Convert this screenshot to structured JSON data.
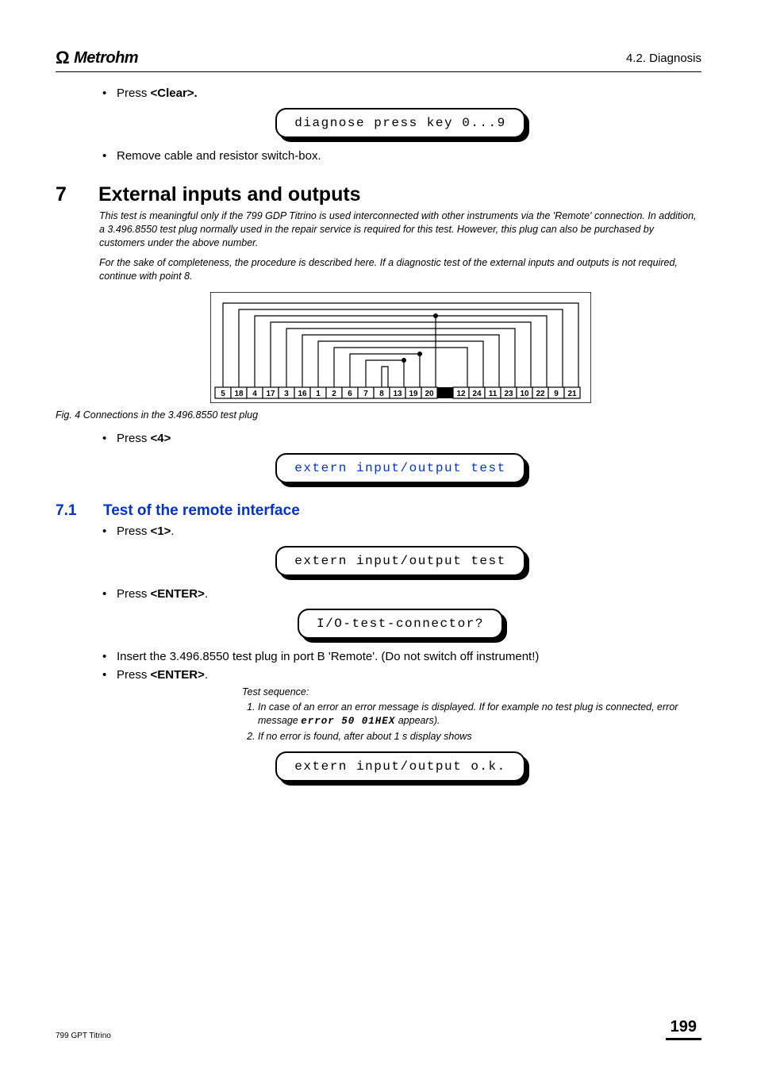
{
  "header": {
    "brand": "Metrohm",
    "section_label": "4.2. Diagnosis"
  },
  "intro_bullets": {
    "press_text": "Press ",
    "clear_key": "<Clear>.",
    "remove_text": "Remove cable and resistor switch-box."
  },
  "displays": {
    "diagnose": "diagnose press key 0...9",
    "extern_test_blue": "extern input/output test",
    "extern_test": "extern input/output test",
    "io_connector": "I/O-test-connector?",
    "extern_ok": "extern input/output o.k."
  },
  "section7": {
    "num": "7",
    "title": "External inputs and outputs",
    "note1": "This test is meaningful only if the 799 GDP Titrino is used interconnected with other instruments via the 'Remote' connection. In addition, a 3.496.8550 test plug normally used in the repair service is required for this test. However, this plug can also be purchased by customers under the above number.",
    "note2": "For the sake of completeness, the procedure is described here. If a diagnostic test of the external inputs and outputs is not required, continue with point 8.",
    "fig_caption": "Fig. 4      Connections in the 3.496.8550 test plug",
    "press4_text": "Press ",
    "press4_key": "<4>",
    "plug_pins": [
      "5",
      "18",
      "4",
      "17",
      "3",
      "16",
      "1",
      "2",
      "6",
      "7",
      "8",
      "13",
      "19",
      "20",
      "",
      "12",
      "24",
      "11",
      "23",
      "10",
      "22",
      "9",
      "21"
    ]
  },
  "section71": {
    "num": "7.1",
    "title": "Test of the remote interface",
    "press1_text": "Press ",
    "press1_key": "<1>",
    "press1_suffix": ".",
    "press_enter_text": "Press ",
    "enter_key": "<ENTER>",
    "enter_suffix": ".",
    "insert_text": "Insert the 3.496.8550 test plug in port B 'Remote'. (Do not switch off instrument!)",
    "press_enter2_text": "Press ",
    "test_seq_title": "Test sequence:",
    "seq1a": "In case of an error an error message is displayed. If for example no test plug is connected, error message  ",
    "seq1_code": "error 50    01HEX",
    "seq1b": " appears).",
    "seq2": "If no error is found, after about 1 s display shows"
  },
  "footer": {
    "left": "799 GPT Titrino",
    "page": "199"
  }
}
